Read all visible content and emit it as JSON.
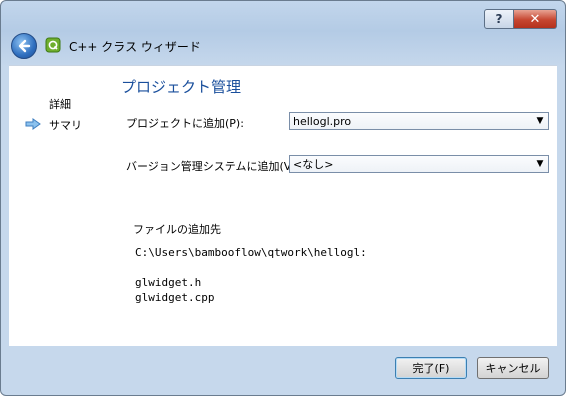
{
  "window": {
    "title": "C++ クラス ウィザード",
    "help_glyph": "?",
    "close_glyph": "✕"
  },
  "sidebar": {
    "items": [
      {
        "label": "詳細"
      },
      {
        "label": "サマリ"
      }
    ],
    "current": "サマリ"
  },
  "main": {
    "heading": "プロジェクト管理",
    "add_to_project_label": "プロジェクトに追加(P):",
    "add_to_project_value": "hellogl.pro",
    "vcs_label": "バージョン管理システムに追加(V):",
    "vcs_value": "<なし>",
    "files_heading": "ファイルの追加先",
    "files_path": "C:\\Users\\bambooflow\\qtwork\\hellogl:",
    "files": [
      "glwidget.h",
      "glwidget.cpp"
    ]
  },
  "footer": {
    "finish_label": "完了(F)",
    "cancel_label": "キャンセル"
  },
  "colors": {
    "heading": "#1a4f9c",
    "frame": "#b4cbe5",
    "close": "#c64630"
  },
  "icons": {
    "back": "back-arrow-icon",
    "app": "qt-creator-icon",
    "current": "current-step-arrow-icon"
  }
}
